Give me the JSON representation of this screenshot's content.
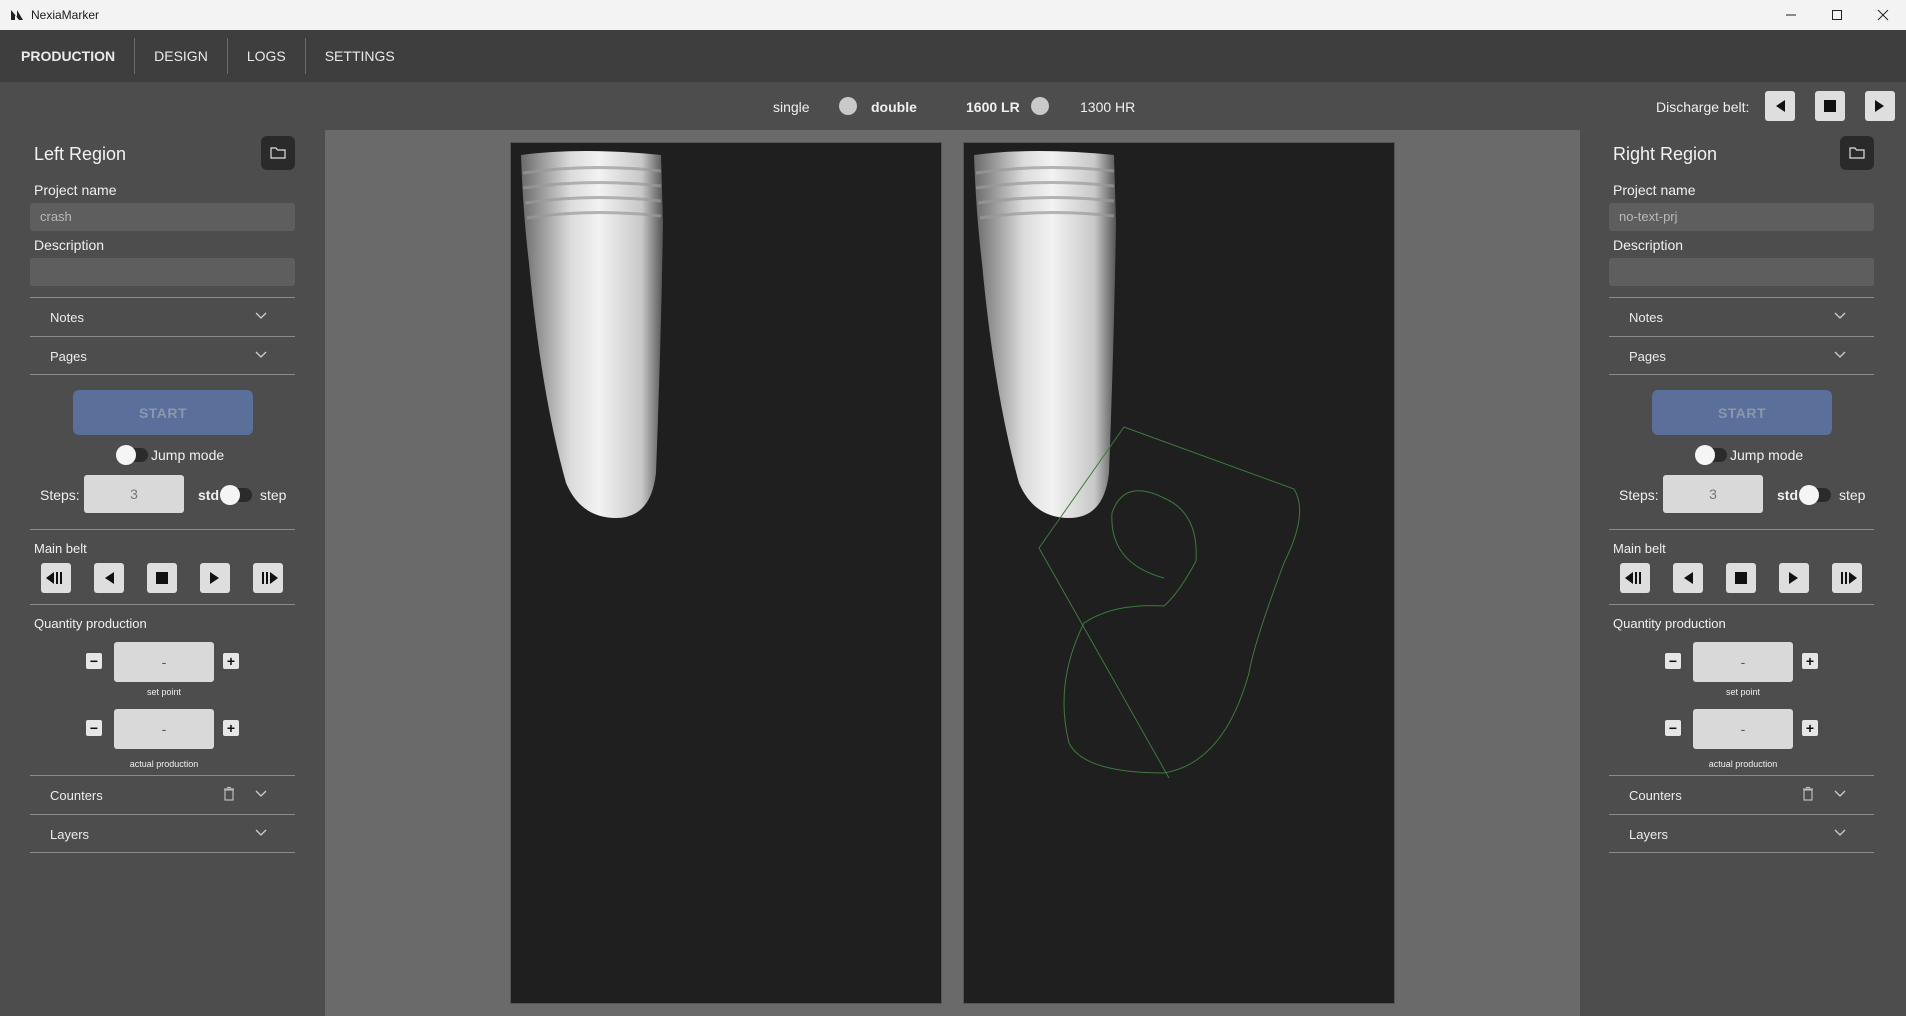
{
  "window": {
    "title": "NexiaMarker",
    "controls": [
      "minimize-icon",
      "maximize-icon",
      "close-icon"
    ]
  },
  "nav": {
    "tabs": [
      {
        "label": "PRODUCTION",
        "active": true
      },
      {
        "label": "DESIGN",
        "active": false
      },
      {
        "label": "LOGS",
        "active": false
      },
      {
        "label": "SETTINGS",
        "active": false
      }
    ]
  },
  "modebar": {
    "single_label": "single",
    "double_label": "double",
    "lr_label": "1600 LR",
    "hr_label": "1300 HR",
    "discharge_label": "Discharge belt:"
  },
  "left": {
    "title": "Left Region",
    "project_label": "Project name",
    "project_value": "crash",
    "description_label": "Description",
    "description_value": "",
    "notes_label": "Notes",
    "pages_label": "Pages",
    "start_label": "START",
    "jump_label": "Jump mode",
    "steps_label": "Steps:",
    "steps_value": "3",
    "std_label": "std",
    "step_label": "step",
    "main_belt_label": "Main belt",
    "quantity_label": "Quantity production",
    "set_point_value": "-",
    "set_point_caption": "set point",
    "actual_value": "-",
    "actual_caption": "actual production",
    "counters_label": "Counters",
    "layers_label": "Layers"
  },
  "right": {
    "title": "Right Region",
    "project_label": "Project name",
    "project_value": "no-text-prj",
    "description_label": "Description",
    "description_value": "",
    "notes_label": "Notes",
    "pages_label": "Pages",
    "start_label": "START",
    "jump_label": "Jump mode",
    "steps_label": "Steps:",
    "steps_value": "3",
    "std_label": "std",
    "step_label": "step",
    "main_belt_label": "Main belt",
    "quantity_label": "Quantity production",
    "set_point_value": "-",
    "set_point_caption": "set point",
    "actual_value": "-",
    "actual_caption": "actual production",
    "counters_label": "Counters",
    "layers_label": "Layers"
  },
  "colors": {
    "background": "#4d4d4d",
    "navbar": "#3e3e3e",
    "start_button": "#5a6f99",
    "canvas": "#6a6a6a",
    "image_bg": "#1f1f1f",
    "design_stroke": "#3d7a3d"
  }
}
